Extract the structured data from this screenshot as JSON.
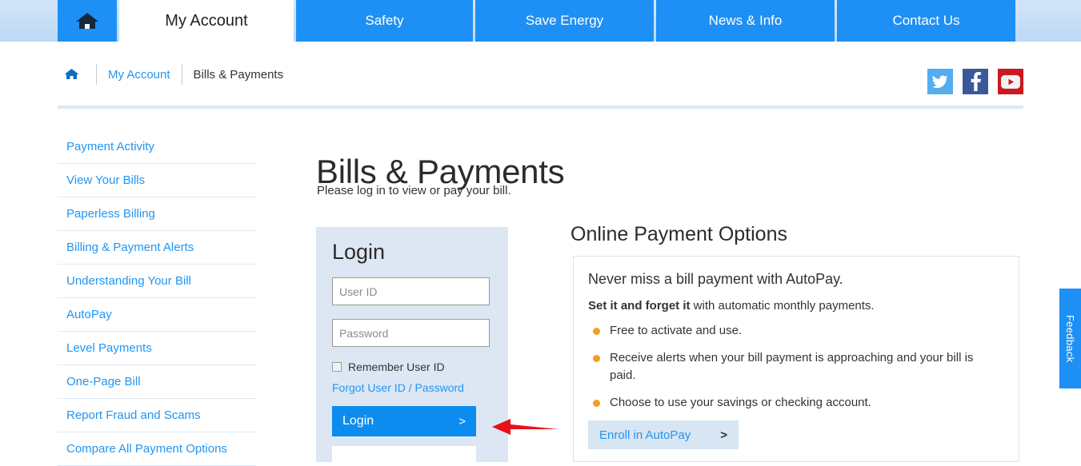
{
  "colors": {
    "nav_blue": "#1e90f5",
    "link_blue": "#2196f3",
    "button_blue": "#0d8cf0",
    "login_panel_bg": "#dde7f3",
    "bullet_orange": "#f0a029",
    "twitter": "#55acee",
    "facebook": "#3b5998",
    "youtube": "#cc181e",
    "annotation_red": "#e8111a"
  },
  "topnav": {
    "home_icon": "home-icon",
    "items": [
      {
        "label": "My Account",
        "active": true
      },
      {
        "label": "Safety",
        "active": false
      },
      {
        "label": "Save Energy",
        "active": false
      },
      {
        "label": "News & Info",
        "active": false
      },
      {
        "label": "Contact Us",
        "active": false
      }
    ]
  },
  "breadcrumb": {
    "home_icon": "home-icon",
    "link": "My Account",
    "current": "Bills & Payments"
  },
  "social": [
    {
      "name": "twitter-icon",
      "label": "Twitter"
    },
    {
      "name": "facebook-icon",
      "label": "Facebook"
    },
    {
      "name": "youtube-icon",
      "label": "YouTube"
    }
  ],
  "sidebar": {
    "items": [
      {
        "label": "Payment Activity"
      },
      {
        "label": "View Your Bills"
      },
      {
        "label": "Paperless Billing"
      },
      {
        "label": "Billing & Payment Alerts"
      },
      {
        "label": "Understanding Your Bill"
      },
      {
        "label": "AutoPay"
      },
      {
        "label": "Level Payments"
      },
      {
        "label": "One-Page Bill"
      },
      {
        "label": "Report Fraud and Scams"
      },
      {
        "label": "Compare All Payment Options"
      }
    ]
  },
  "main": {
    "title": "Bills & Payments",
    "subtitle": "Please log in to view or pay your bill."
  },
  "login": {
    "title": "Login",
    "user_id_value": "",
    "user_id_placeholder": "User ID",
    "password_value": "",
    "password_placeholder": "Password",
    "remember_label": "Remember User ID",
    "remember_checked": false,
    "forgot_label": "Forgot User ID / Password",
    "submit_label": "Login",
    "submit_chevron": ">"
  },
  "payment_options": {
    "title": "Online Payment Options",
    "card": {
      "heading": "Never miss a bill payment with AutoPay.",
      "subhead_bold": "Set it and forget it",
      "subhead_rest": " with automatic monthly payments.",
      "bullets": [
        "Free to activate and use.",
        "Receive alerts when your bill payment is approaching and your bill is paid.",
        "Choose to use your savings or checking account."
      ],
      "enroll_label": "Enroll in AutoPay",
      "enroll_chevron": ">"
    }
  },
  "feedback": {
    "label": "Feedback"
  },
  "annotation": {
    "type": "arrow",
    "direction": "left",
    "target": "login-button"
  }
}
